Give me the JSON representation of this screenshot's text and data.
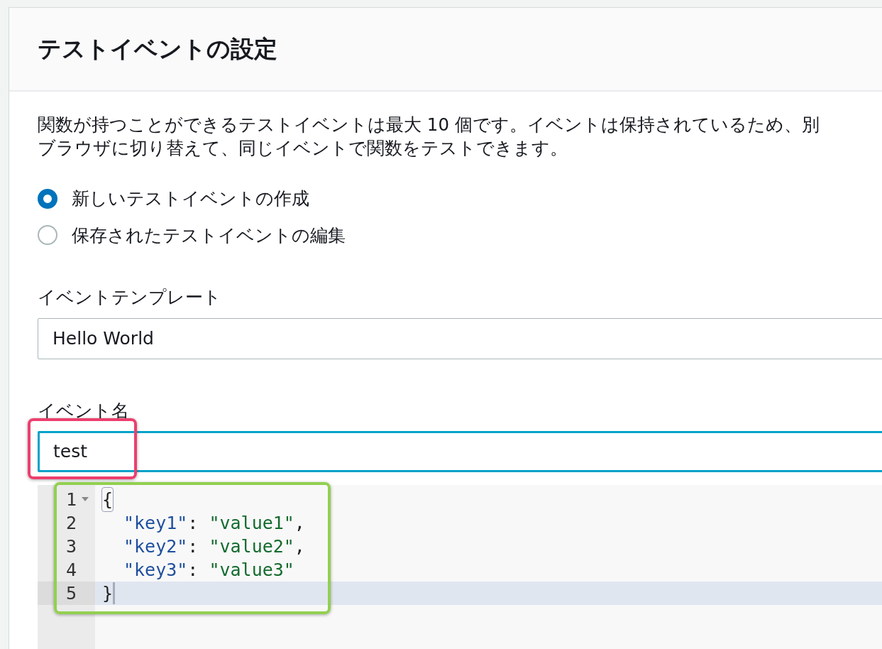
{
  "dialog": {
    "title": "テストイベントの設定",
    "description": [
      "関数が持つことができるテストイベントは最大 10 個です。イベントは保持されているため、別",
      "ブラウザに切り替えて、同じイベントで関数をテストできます。"
    ],
    "options": [
      {
        "label": "新しいテストイベントの作成",
        "selected": true
      },
      {
        "label": "保存されたテストイベントの編集",
        "selected": false
      }
    ],
    "template": {
      "label": "イベントテンプレート",
      "value": "Hello World"
    },
    "event_name": {
      "label": "イベント名",
      "value": "test",
      "focused": true
    },
    "editor": {
      "lines": [
        {
          "number": "1",
          "fold": true,
          "active": false,
          "indented": false,
          "tokens": [
            {
              "kind": "punct",
              "text": "{",
              "matched": true
            }
          ]
        },
        {
          "number": "2",
          "fold": false,
          "active": false,
          "indented": true,
          "tokens": [
            {
              "kind": "key",
              "text": "\"key1\""
            },
            {
              "kind": "punct",
              "text": ": "
            },
            {
              "kind": "value",
              "text": "\"value1\""
            },
            {
              "kind": "punct",
              "text": ","
            }
          ]
        },
        {
          "number": "3",
          "fold": false,
          "active": false,
          "indented": true,
          "tokens": [
            {
              "kind": "key",
              "text": "\"key2\""
            },
            {
              "kind": "punct",
              "text": ": "
            },
            {
              "kind": "value",
              "text": "\"value2\""
            },
            {
              "kind": "punct",
              "text": ","
            }
          ]
        },
        {
          "number": "4",
          "fold": false,
          "active": false,
          "indented": true,
          "tokens": [
            {
              "kind": "key",
              "text": "\"key3\""
            },
            {
              "kind": "punct",
              "text": ": "
            },
            {
              "kind": "value",
              "text": "\"value3\""
            }
          ]
        },
        {
          "number": "5",
          "fold": false,
          "active": true,
          "indented": false,
          "cursor": true,
          "tokens": [
            {
              "kind": "punct",
              "text": "}",
              "matched": false
            }
          ]
        }
      ]
    },
    "annotations": [
      {
        "color": "#ec3f6e"
      },
      {
        "color": "#92d050"
      }
    ]
  }
}
